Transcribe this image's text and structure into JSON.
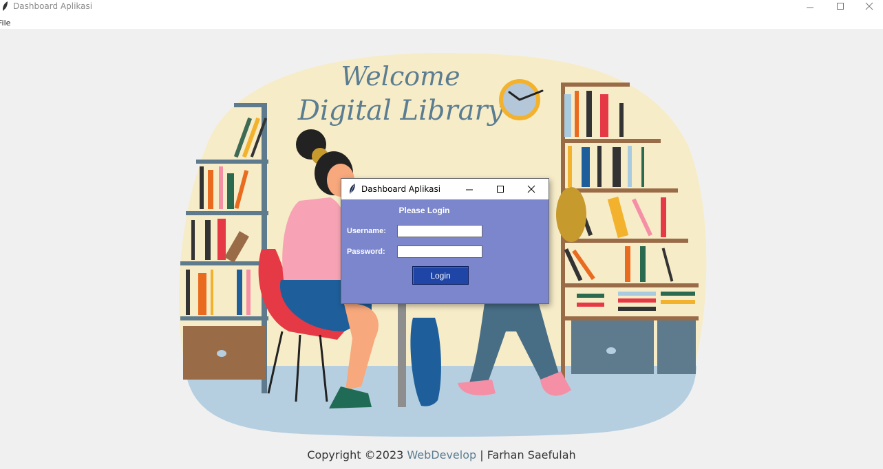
{
  "window": {
    "title": "Dashboard Aplikasi",
    "icon": "feather-icon",
    "controls": [
      "minimize-icon",
      "maximize-icon",
      "close-icon"
    ]
  },
  "menubar": {
    "file_label": "File"
  },
  "background": {
    "welcome_line1": "Welcome",
    "welcome_line2": "Digital Library"
  },
  "footer": {
    "prefix": "Copyright ©2023 ",
    "link": "WebDevelop",
    "suffix": " | Farhan Saefulah"
  },
  "dialog": {
    "title": "Dashboard Aplikasi",
    "heading": "Please Login",
    "username_label": "Username:",
    "username_value": "",
    "password_label": "Password:",
    "password_value": "",
    "login_label": "Login"
  },
  "colors": {
    "dialog_bg": "#7b86cc",
    "login_button": "#1f45a6",
    "welcome_text": "#5b7d91",
    "blob_bg": "#f7ecc8",
    "floor": "#b5cfe0"
  }
}
